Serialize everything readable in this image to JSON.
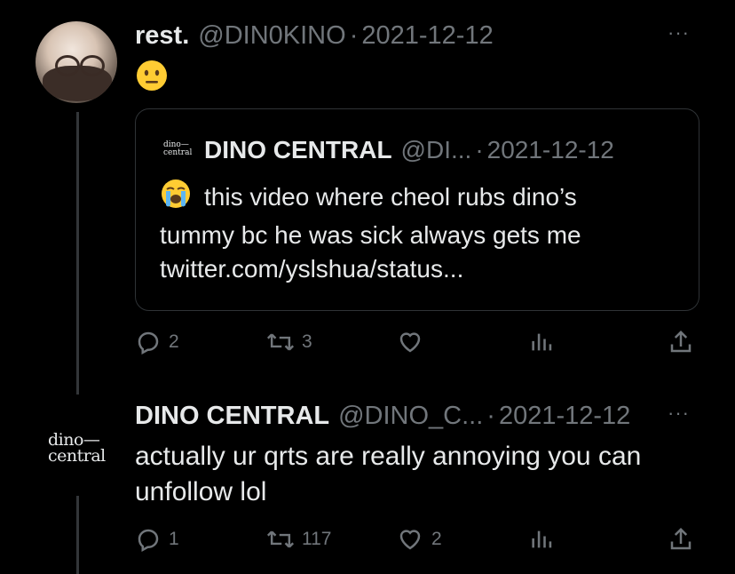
{
  "tweet": {
    "display_name": "rest.",
    "handle": "@DIN0KINO",
    "separator": "·",
    "date": "2021-12-12",
    "emoji": "neutral-face",
    "more_label": "···"
  },
  "quoted": {
    "logo_text_line1": "dino—",
    "logo_text_line2": "central",
    "display_name": "DINO CENTRAL",
    "handle": "@DI...",
    "separator": "·",
    "date": "2021-12-12",
    "emoji": "loudly-crying-face",
    "text_line1": "this video where cheol rubs dino’s",
    "text_line2": "tummy bc he was sick always gets me",
    "text_line3": "twitter.com/yslshua/status..."
  },
  "tweet_actions": {
    "replies": "2",
    "retweets": "3",
    "likes": "",
    "views": "",
    "share": ""
  },
  "reply": {
    "logo_line1": "dino—",
    "logo_line2": "central",
    "display_name": "DINO CENTRAL",
    "handle": "@DINO_C...",
    "separator": "·",
    "date": "2021-12-12",
    "more_label": "···",
    "text_line1": "actually ur qrts are really annoying you can",
    "text_line2": "unfollow lol"
  },
  "reply_actions": {
    "replies": "1",
    "retweets": "117",
    "likes": "2"
  },
  "colors": {
    "background": "#000000",
    "text": "#e7e9ea",
    "muted": "#71767b",
    "border": "#2f3336"
  }
}
